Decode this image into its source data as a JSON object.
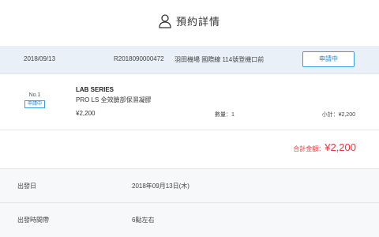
{
  "header": {
    "title": "預約詳情",
    "icon": "user-icon"
  },
  "order": {
    "date": "2018/09/13",
    "order_no": "R2018090000472",
    "location": "羽田機場 國際線 114號登機口前",
    "status_button": "申請中"
  },
  "item": {
    "number": "No.1",
    "badge": "申請中",
    "brand": "LAB SERIES",
    "name": "PRO LS 全效臉部保濕凝膠",
    "price": "¥2,200",
    "quantity": "數量：1",
    "subtotal": "小計：¥2,200"
  },
  "total": {
    "label": "合計金額：",
    "value": "¥2,200"
  },
  "details": {
    "departure_date_label": "出發日",
    "departure_date_value": "2018年09月13日(木)",
    "departure_time_label": "出發時間帶",
    "departure_time_value": "6點左右"
  },
  "colors": {
    "accent": "#1e87d8",
    "total_red": "#e4393c",
    "bar_bg": "#e9f0f8",
    "row_bg": "#f7f8f9"
  }
}
